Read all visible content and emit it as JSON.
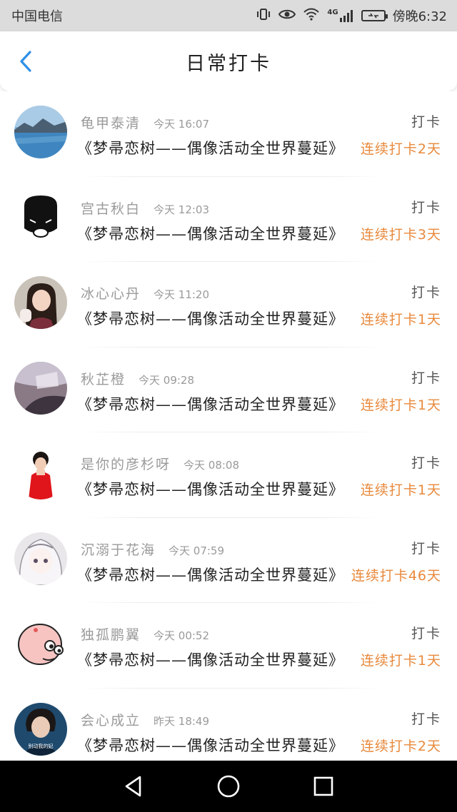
{
  "status_bar": {
    "carrier": "中国电信",
    "icons": [
      "vibrate-icon",
      "eye-icon",
      "wifi-icon",
      "4g-signal-icon",
      "battery-icon"
    ],
    "network": "4G",
    "time": "傍晚6:32"
  },
  "header": {
    "title": "日常打卡",
    "back_icon": "chevron-left-icon",
    "accent_color": "#2f8fe8"
  },
  "colors": {
    "streak": "#e8893c",
    "username": "#9a9a9a"
  },
  "items": [
    {
      "username": "龟甲泰清",
      "time": "今天 16:07",
      "checkin_label": "打卡",
      "activity": "《梦帚恋树——偶像活动全世界蔓延》",
      "streak": "连续打卡2天",
      "avatar": "landscape"
    },
    {
      "username": "宫古秋白",
      "time": "今天 12:03",
      "checkin_label": "打卡",
      "activity": "《梦帚恋树——偶像活动全世界蔓延》",
      "streak": "连续打卡3天",
      "avatar": "cartoon-black"
    },
    {
      "username": "冰心心丹",
      "time": "今天 11:20",
      "checkin_label": "打卡",
      "activity": "《梦帚恋树——偶像活动全世界蔓延》",
      "streak": "连续打卡1天",
      "avatar": "girl-photo"
    },
    {
      "username": "秋芷橙",
      "time": "今天 09:28",
      "checkin_label": "打卡",
      "activity": "《梦帚恋树——偶像活动全世界蔓延》",
      "streak": "连续打卡1天",
      "avatar": "blurry-photo"
    },
    {
      "username": "是你的彦杉呀",
      "time": "今天 08:08",
      "checkin_label": "打卡",
      "activity": "《梦帚恋树——偶像活动全世界蔓延》",
      "streak": "连续打卡1天",
      "avatar": "red-dress"
    },
    {
      "username": "沉溺于花海",
      "time": "今天 07:59",
      "checkin_label": "打卡",
      "activity": "《梦帚恋树——偶像活动全世界蔓延》",
      "streak": "连续打卡46天",
      "avatar": "anime-girl"
    },
    {
      "username": "独孤鹏翼",
      "time": "今天 00:52",
      "checkin_label": "打卡",
      "activity": "《梦帚恋树——偶像活动全世界蔓延》",
      "streak": "连续打卡1天",
      "avatar": "pink-pig"
    },
    {
      "username": "会心成立",
      "time": "昨天 18:49",
      "checkin_label": "打卡",
      "activity": "《梦帚恋树——偶像活动全世界蔓延》",
      "streak": "连续打卡2天",
      "avatar": "boy-photo",
      "avatar_caption": "别动我的妃"
    }
  ],
  "nav_bar": {
    "icons": [
      "back-triangle-icon",
      "home-circle-icon",
      "recents-square-icon"
    ]
  }
}
